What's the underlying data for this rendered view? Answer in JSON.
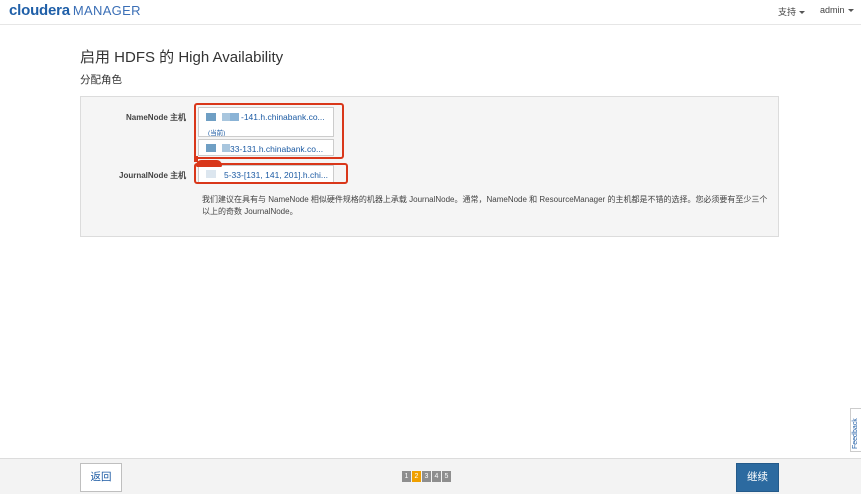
{
  "header": {
    "logo_main": "cloudera",
    "logo_sub": "MANAGER",
    "support_label": "支持",
    "user_label": "admin"
  },
  "page": {
    "title": "启用 HDFS 的 High Availability",
    "subtitle": "分配角色"
  },
  "roles": {
    "namenode_label": "NameNode 主机",
    "namenode_hosts": [
      {
        "text": "-141.h.chinabank.co...",
        "sub": "(当前)"
      },
      {
        "text": "33-131.h.chinabank.co...",
        "sub": ""
      }
    ],
    "journalnode_label": "JournalNode 主机",
    "journalnode_hosts": "5-33-[131, 141, 201].h.chi..."
  },
  "note": "我们建议在具有与 NameNode 相似硬件规格的机器上承载 JournalNode。通常，NameNode 和 ResourceManager 的主机都是不错的选择。您必须要有至少三个以上的奇数 JournalNode。",
  "footer": {
    "back_label": "返回",
    "next_label": "继续",
    "steps": [
      "1",
      "2",
      "3",
      "4",
      "5"
    ],
    "active_step": "2"
  },
  "feedback_label": "Feedback",
  "colors": {
    "brand": "#1f5fa8",
    "primary_button": "#2c6aa0",
    "highlight": "#d9371a",
    "active_step": "#f0a000"
  }
}
